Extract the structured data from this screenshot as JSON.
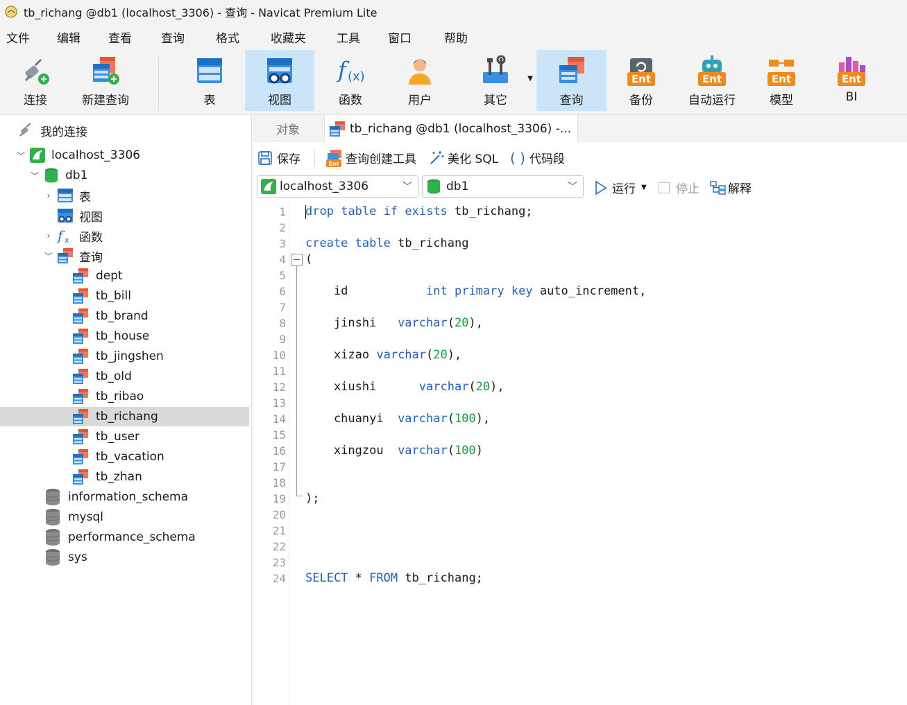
{
  "window": {
    "title": "tb_richang @db1 (localhost_3306) - 查询 - Navicat Premium Lite"
  },
  "menu": [
    "文件",
    "编辑",
    "查看",
    "查询",
    "格式",
    "收藏夹",
    "工具",
    "窗口",
    "帮助"
  ],
  "toolbar": {
    "connect": "连接",
    "new_query": "新建查询",
    "table": "表",
    "view": "视图",
    "function": "函数",
    "user": "用户",
    "other": "其它",
    "query": "查询",
    "backup": "备份",
    "automation": "自动运行",
    "model": "模型",
    "bi": "BI",
    "ent_badge": "Ent"
  },
  "sidebar": {
    "header": "我的连接",
    "connection": "localhost_3306",
    "database": "db1",
    "nodes": {
      "tables": "表",
      "views": "视图",
      "functions": "函数",
      "queries": "查询"
    },
    "queries": [
      "dept",
      "tb_bill",
      "tb_brand",
      "tb_house",
      "tb_jingshen",
      "tb_old",
      "tb_ribao",
      "tb_richang",
      "tb_user",
      "tb_vacation",
      "tb_zhan"
    ],
    "selected_query": "tb_richang",
    "other_databases": [
      "information_schema",
      "mysql",
      "performance_schema",
      "sys"
    ]
  },
  "tabs": {
    "objects": "对象",
    "query_tab": "tb_richang @db1 (localhost_3306) -..."
  },
  "query_toolbar": {
    "save": "保存",
    "builder": "查询创建工具",
    "beautify": "美化 SQL",
    "snippet": "代码段",
    "ent_badge": "Ent"
  },
  "connection_bar": {
    "connection": "localhost_3306",
    "database": "db1",
    "run": "运行",
    "stop": "停止",
    "explain": "解释"
  },
  "editor": {
    "line_numbers": [
      "1",
      "2",
      "3",
      "4",
      "5",
      "6",
      "7",
      "8",
      "9",
      "10",
      "11",
      "12",
      "13",
      "14",
      "15",
      "16",
      "17",
      "18",
      "19",
      "20",
      "21",
      "22",
      "23",
      "24"
    ],
    "lines": {
      "l1": {
        "k1": "drop",
        "s1": " ",
        "k2": "table",
        "s2": " ",
        "k3": "if",
        "s3": " ",
        "k4": "exists",
        "t": " tb_richang;"
      },
      "l3": {
        "k1": "create",
        "s1": " ",
        "k2": "table",
        "t": " tb_richang"
      },
      "l4": "(",
      "l6": {
        "a": "    id           ",
        "k1": "int",
        "s1": " ",
        "k2": "primary",
        "s2": " ",
        "k3": "key",
        "t": " auto_increment,"
      },
      "l8": {
        "a": "    jinshi   ",
        "k": "varchar",
        "p1": "(",
        "n": "20",
        "p2": "),"
      },
      "l10": {
        "a": "    xizao ",
        "k": "varchar",
        "p1": "(",
        "n": "20",
        "p2": "),"
      },
      "l12": {
        "a": "    xiushi      ",
        "k": "varchar",
        "p1": "(",
        "n": "20",
        "p2": "),"
      },
      "l14": {
        "a": "    chuanyi  ",
        "k": "varchar",
        "p1": "(",
        "n": "100",
        "p2": "),"
      },
      "l16": {
        "a": "    xingzou  ",
        "k": "varchar",
        "p1": "(",
        "n": "100",
        "p2": ")"
      },
      "l19": ");",
      "l24": {
        "k1": "SELECT",
        "t1": " * ",
        "k2": "FROM",
        "t2": " tb_richang;"
      }
    }
  },
  "colors": {
    "keyword": "#1f5fc8",
    "number": "#15a035",
    "selection": "#cce4f7",
    "accent_orange": "#f08a1c"
  }
}
